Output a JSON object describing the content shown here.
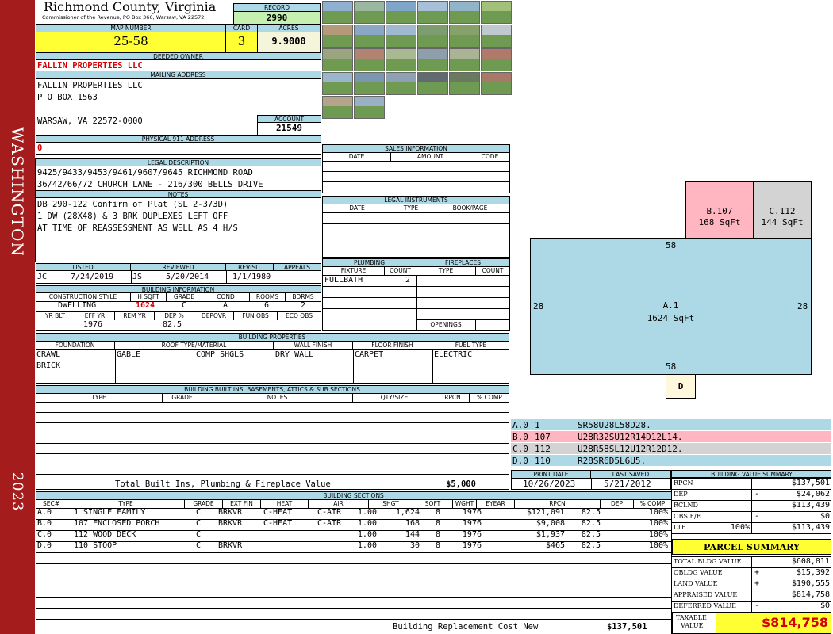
{
  "sidebar": {
    "county_vertical": "WASHINGTON",
    "year": "2023"
  },
  "header": {
    "title": "Richmond County, Virginia",
    "subtitle": "Commissioner of the Revenue, PO Box 366, Warsaw, VA 22572",
    "record_label": "RECORD",
    "record_value": "2990",
    "map_number_label": "MAP NUMBER",
    "map_number": "25-58",
    "card_label": "CARD",
    "card": "3",
    "acres_label": "ACRES",
    "acres": "9.9000"
  },
  "owner": {
    "deeded_label": "DEEDED OWNER",
    "deeded_owner": "FALLIN PROPERTIES LLC",
    "mailing_label": "MAILING ADDRESS",
    "mailing_line1": "FALLIN PROPERTIES LLC",
    "mailing_line2": "P O BOX 1563",
    "mailing_line3": "WARSAW, VA 22572-0000",
    "account_label": "ACCOUNT",
    "account": "21549",
    "physical_label": "PHYSICAL 911 ADDRESS",
    "physical": "0"
  },
  "legal": {
    "label": "LEGAL DESCRIPTION",
    "line1": "9425/9433/9453/9461/9607/9645 RICHMOND ROAD",
    "line2": "36/42/66/72 CHURCH LANE - 216/300 BELLS DRIVE"
  },
  "notes": {
    "label": "NOTES",
    "line1": "DB 290-122 Confirm of Plat (SL 2-373D)",
    "line2": "1 DW (28X48) & 3 BRK DUPLEXES LEFT OFF",
    "line3": "AT TIME OF REASSESSMENT AS WELL AS 4 H/S"
  },
  "review": {
    "listed_label": "LISTED",
    "listed_by": "JC",
    "listed_date": "7/24/2019",
    "reviewed_label": "REVIEWED",
    "reviewed_by": "JS",
    "reviewed_date": "5/20/2014",
    "revisit_label": "REVISIT",
    "revisit_date": "1/1/1980",
    "appeals_label": "APPEALS"
  },
  "building_info": {
    "label": "BUILDING INFORMATION",
    "h_construction": "CONSTRUCTION STYLE",
    "h_hsqft": "H SQFT",
    "h_grade": "GRADE",
    "h_cond": "COND",
    "h_rooms": "ROOMS",
    "h_bdrms": "BDRMS",
    "construction": "DWELLING",
    "hsqft": "1624",
    "grade": "C",
    "cond": "A",
    "rooms": "6",
    "bdrms": "2",
    "h_yrblt": "YR BLT",
    "h_effyr": "EFF YR",
    "h_remyr": "REM YR",
    "h_dep": "DEP %",
    "h_depovr": "DEPOVR",
    "h_funobs": "FUN OBS",
    "h_ecoobs": "ECO OBS",
    "effyr": "1976",
    "dep": "82.5"
  },
  "sales": {
    "label": "SALES INFORMATION",
    "h_date": "DATE",
    "h_amount": "AMOUNT",
    "h_code": "CODE"
  },
  "instruments": {
    "label": "LEGAL INSTRUMENTS",
    "h_date": "DATE",
    "h_type": "TYPE",
    "h_book": "BOOK/PAGE"
  },
  "plumbing": {
    "label": "PLUMBING",
    "h_fixture": "FIXTURE",
    "h_count": "COUNT",
    "fixture": "FULLBATH",
    "count": "2"
  },
  "fireplaces": {
    "label": "FIREPLACES",
    "h_type": "TYPE",
    "h_count": "COUNT",
    "openings_label": "OPENINGS"
  },
  "properties": {
    "label": "BUILDING PROPERTIES",
    "h_foundation": "FOUNDATION",
    "h_roof": "ROOF TYPE/MATERIAL",
    "h_wall": "WALL FINISH",
    "h_floor": "FLOOR FINISH",
    "h_fuel": "FUEL TYPE",
    "foundation1": "CRAWL",
    "foundation2": "BRICK",
    "roof_type": "GABLE",
    "roof_material": "COMP SHGLS",
    "wall": "DRY WALL",
    "floor": "CARPET",
    "fuel": "ELECTRIC"
  },
  "builtins": {
    "label": "BUILDING BUILT INS, BASEMENTS, ATTICS & SUB SECTIONS",
    "h_type": "TYPE",
    "h_grade": "GRADE",
    "h_notes": "NOTES",
    "h_qty": "QTY/SIZE",
    "h_rpcn": "RPCN",
    "h_comp": "% COMP",
    "total_label": "Total Built Ins, Plumbing & Fireplace Value",
    "total_value": "$5,000"
  },
  "print": {
    "print_label": "PRINT DATE",
    "print_date": "10/26/2023",
    "saved_label": "LAST SAVED",
    "saved_date": "5/21/2012"
  },
  "sketch": {
    "main": {
      "label": "A.1",
      "area": "1624 SqFt",
      "top": "58",
      "bottom": "58",
      "left": "28",
      "right": "28"
    },
    "b": {
      "label": "B.107",
      "area": "168 SqFt"
    },
    "c": {
      "label": "C.112",
      "area": "144 SqFt"
    },
    "d": {
      "label": "D"
    }
  },
  "sketch_codes": [
    {
      "sec": "A.0",
      "code": "1",
      "path": "SR58U28L58D28.",
      "bg": "#add8e6"
    },
    {
      "sec": "B.0",
      "code": "107",
      "path": "U28R32SU12R14D12L14.",
      "bg": "#ffb6c1"
    },
    {
      "sec": "C.0",
      "code": "112",
      "path": "U28R58SL12U12R12D12.",
      "bg": "#d3d3d3"
    },
    {
      "sec": "D.0",
      "code": "110",
      "path": "R28SR6D5L6U5.",
      "bg": "#add8e6"
    }
  ],
  "sections": {
    "label": "BUILDING SECTIONS",
    "headers": [
      "SEC#",
      "TYPE",
      "GRADE",
      "EXT FIN",
      "HEAT",
      "AIR",
      "SHGT",
      "SQFT",
      "WGHT",
      "EYEAR",
      "RPCN",
      "DEP",
      "% COMP"
    ],
    "rows": [
      [
        "A.0",
        "1 SINGLE FAMILY",
        "C",
        "BRKVR",
        "C-HEAT",
        "C-AIR",
        "1.00",
        "1,624",
        "8",
        "1976",
        "$121,091",
        "82.5",
        "100%"
      ],
      [
        "B.0",
        "107 ENCLOSED PORCH",
        "C",
        "BRKVR",
        "C-HEAT",
        "C-AIR",
        "1.00",
        "168",
        "8",
        "1976",
        "$9,008",
        "82.5",
        "100%"
      ],
      [
        "C.0",
        "112 WOOD DECK",
        "C",
        "",
        "",
        "",
        "1.00",
        "144",
        "8",
        "1976",
        "$1,937",
        "82.5",
        "100%"
      ],
      [
        "D.0",
        "110 STOOP",
        "C",
        "BRKVR",
        "",
        "",
        "1.00",
        "30",
        "8",
        "1976",
        "$465",
        "82.5",
        "100%"
      ]
    ],
    "replacement_label": "Building Replacement Cost New",
    "replacement_value": "$137,501"
  },
  "value_summary": {
    "label": "BUILDING VALUE SUMMARY",
    "rows": [
      {
        "label": "RPCN",
        "sign": "",
        "pct": "",
        "value": "$137,501"
      },
      {
        "label": "DEP",
        "sign": "-",
        "pct": "",
        "value": "$24,062"
      },
      {
        "label": "RCLND",
        "sign": "",
        "pct": "",
        "value": "$113,439"
      },
      {
        "label": "OBS F/E",
        "sign": "-",
        "pct": "",
        "value": "$0"
      },
      {
        "label": "LTF",
        "sign": "",
        "pct": "100%",
        "value": "$113,439"
      }
    ]
  },
  "parcel": {
    "label": "PARCEL SUMMARY",
    "rows": [
      {
        "label": "TOTAL BLDG VALUE",
        "sign": "",
        "value": "$608,811"
      },
      {
        "label": "OBLDG VALUE",
        "sign": "+",
        "value": "$15,392"
      },
      {
        "label": "LAND VALUE",
        "sign": "+",
        "value": "$190,555"
      },
      {
        "label": "APPRAISED VALUE",
        "sign": "",
        "value": "$814,758"
      },
      {
        "label": "DEFERRED VALUE",
        "sign": "-",
        "value": "$0"
      }
    ],
    "taxable_label1": "TAXABLE",
    "taxable_label2": "VALUE",
    "taxable_value": "$814,758"
  },
  "photos": {
    "colors": [
      "#8fb0d0",
      "#9ab8a0",
      "#7fa6c9",
      "#a8bfd8",
      "#92b4c8",
      "#a2c07a",
      "#b49a7a",
      "#8aa8c4",
      "#a0b8d0",
      "#7e9d6e",
      "#86a26a",
      "#c0c8d0",
      "#9aa47e",
      "#b08470",
      "#a8b890",
      "#8e9eaa",
      "#aab494",
      "#b07a6a",
      "#9bb6cc",
      "#7a96b0",
      "#8ea0b4",
      "#606a70",
      "#6a7a5e",
      "#a87868",
      "#b4a48c",
      "#9ab0c4"
    ]
  }
}
